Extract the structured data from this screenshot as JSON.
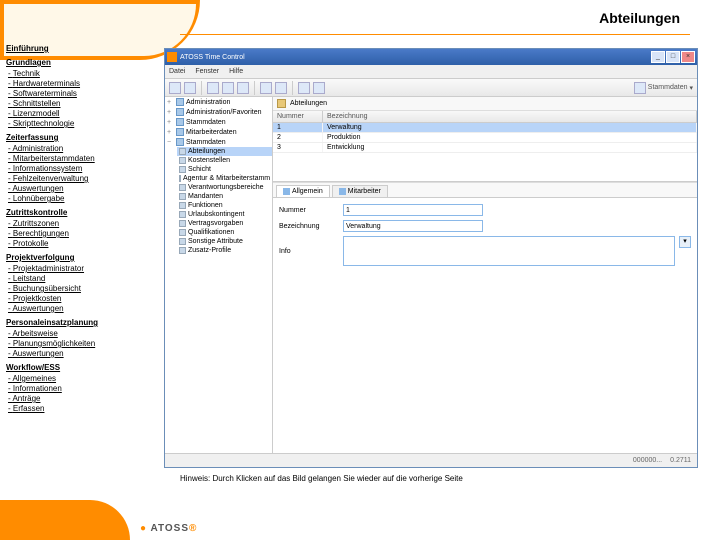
{
  "page": {
    "title": "Abteilungen",
    "hint": "Hinweis: Durch Klicken auf das Bild gelangen Sie wieder auf die vorherige Seite",
    "logo": "ATOSS"
  },
  "nav": {
    "sections": [
      {
        "title": "Einführung",
        "items": []
      },
      {
        "title": "Grundlagen",
        "items": [
          "Technik",
          "Hardwareterminals",
          "Softwareterminals",
          "Schnittstellen",
          "Lizenzmodell",
          "Skripttechnologie"
        ]
      },
      {
        "title": "Zeiterfassung",
        "items": [
          "Administration",
          "Mitarbeiterstammdaten",
          "Informationssystem",
          "Fehlzeitenverwaltung",
          "Auswertungen",
          "Lohnübergabe"
        ]
      },
      {
        "title": "Zutrittskontrolle",
        "items": [
          "Zutrittszonen",
          "Berechtigungen",
          "Protokolle"
        ]
      },
      {
        "title": "Projektverfolgung",
        "items": [
          "Projektadministrator",
          "Leitstand",
          "Buchungsübersicht",
          "Projektkosten",
          "Auswertungen"
        ]
      },
      {
        "title": "Personaleinsatzplanung",
        "items": [
          "Arbeitsweise",
          "Planungsmöglichkeiten",
          "Auswertungen"
        ]
      },
      {
        "title": "Workflow/ESS",
        "items": [
          "Allgemeines",
          "Informationen",
          "Anträge",
          "Erfassen"
        ]
      }
    ]
  },
  "app": {
    "title": "ATOSS Time Control",
    "menu": [
      "Datei",
      "Fenster",
      "Hilfe"
    ],
    "breadcrumb": "Abteilungen",
    "stammdaten_label": "Stammdaten",
    "tree": {
      "top": [
        {
          "label": "Administration",
          "exp": "+"
        },
        {
          "label": "Administration/Favoriten",
          "exp": "+"
        },
        {
          "label": "Stammdaten",
          "exp": "+"
        },
        {
          "label": "Mitarbeiterdaten",
          "exp": "+"
        },
        {
          "label": "Stammdaten",
          "exp": "−",
          "sel": true
        }
      ],
      "children": [
        "Abteilungen",
        "Kostenstellen",
        "Schicht",
        "Agentur & Mitarbeiterstamm",
        "Verantwortungsbereiche",
        "Mandanten",
        "Funktionen",
        "Urlaubskontingent",
        "Vertragsvorgaben",
        "Qualifikationen",
        "Sonstige Attribute",
        "Zusatz-Profile"
      ]
    },
    "grid": {
      "cols": [
        "Nummer",
        "Bezeichnung"
      ],
      "rows": [
        {
          "n": "1",
          "b": "Verwaltung",
          "sel": true
        },
        {
          "n": "2",
          "b": "Produktion"
        },
        {
          "n": "3",
          "b": "Entwicklung"
        }
      ]
    },
    "tabs": [
      "Allgemein",
      "Mitarbeiter"
    ],
    "form": {
      "nummer_label": "Nummer",
      "nummer_value": "1",
      "bez_label": "Bezeichnung",
      "bez_value": "Verwaltung",
      "info_label": "Info"
    },
    "status": {
      "left": "000000...",
      "right": "0.2711"
    }
  }
}
